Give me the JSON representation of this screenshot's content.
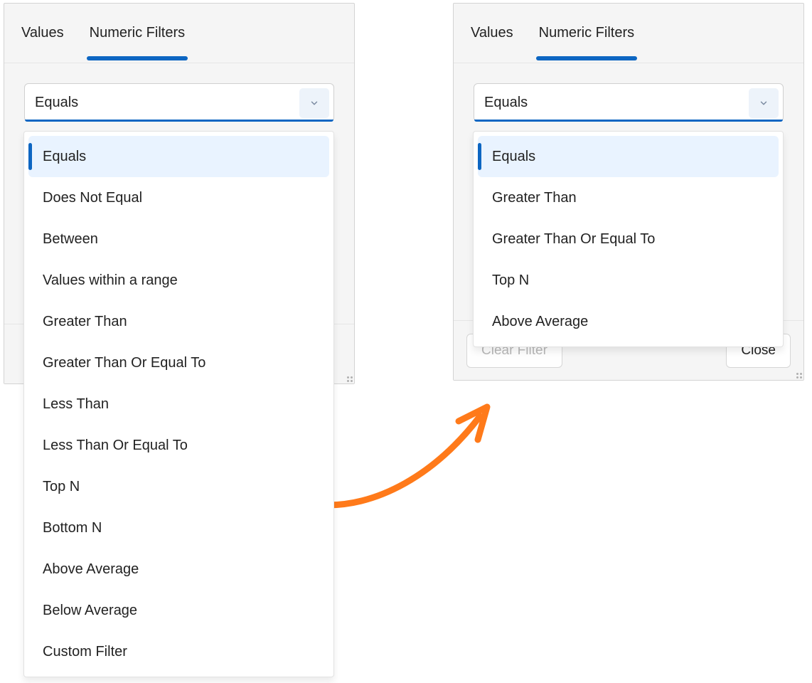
{
  "tabs": {
    "values": "Values",
    "numeric_filters": "Numeric Filters"
  },
  "select": {
    "value": "Equals"
  },
  "footer": {
    "clear": "Clear Filter",
    "close": "Close"
  },
  "left_options": [
    "Equals",
    "Does Not Equal",
    "Between",
    "Values within a range",
    "Greater Than",
    "Greater Than Or Equal To",
    "Less Than",
    "Less Than Or Equal To",
    "Top N",
    "Bottom N",
    "Above Average",
    "Below Average",
    "Custom Filter"
  ],
  "right_options": [
    "Equals",
    "Greater Than",
    "Greater Than Or Equal To",
    "Top N",
    "Above Average"
  ],
  "colors": {
    "accent": "#0d66c2",
    "arrow": "#ff7a1a"
  }
}
